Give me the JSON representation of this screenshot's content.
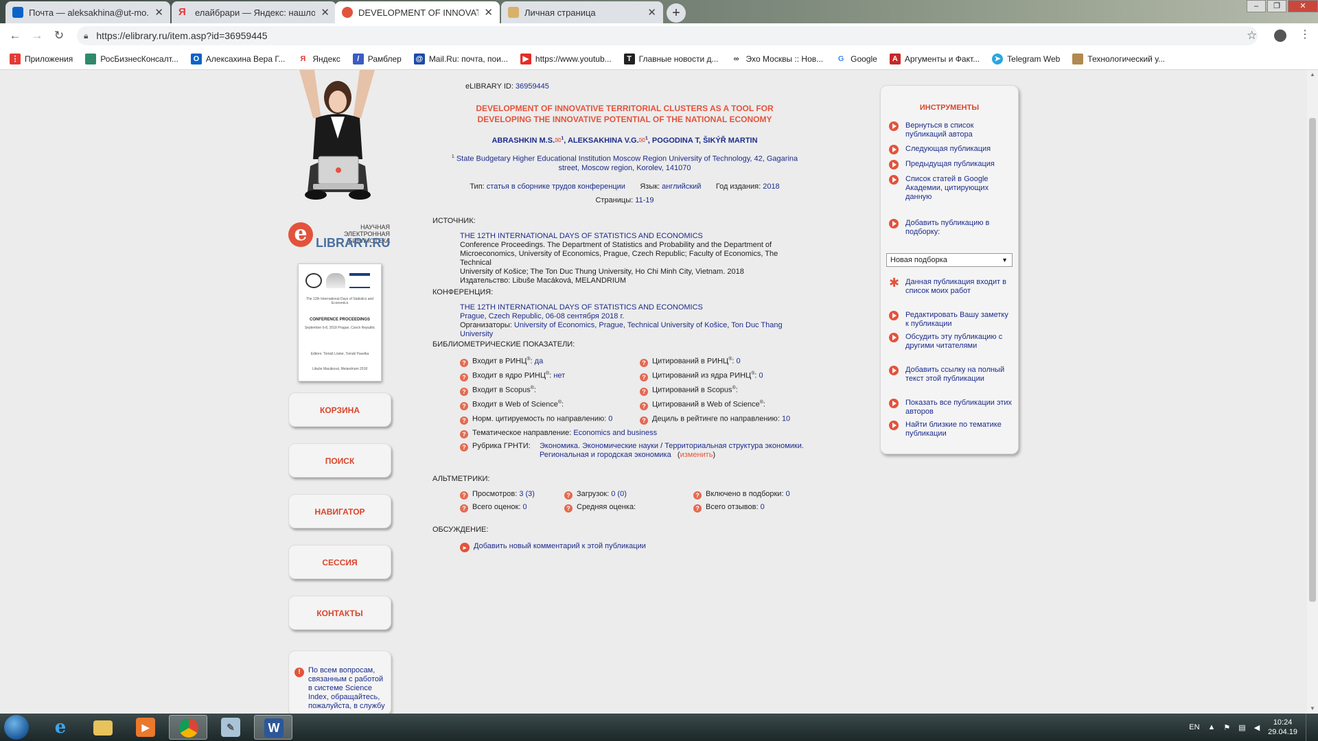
{
  "browser": {
    "tabs": [
      {
        "title": "Почта — aleksakhina@ut-mo.ru",
        "icon": "outlook-icon",
        "color": "#0a64c8"
      },
      {
        "title": "елайбрари — Яндекс: нашлось",
        "icon": "yandex-icon",
        "color": "#e53935"
      },
      {
        "title": "DEVELOPMENT OF INNOVATIVE",
        "icon": "elibrary-icon",
        "color": "#e3533c"
      },
      {
        "title": "Личная страница",
        "icon": "page-icon",
        "color": "#d9b06a"
      }
    ],
    "new_tab": "+",
    "url": "https://elibrary.ru/item.asp?id=36959445",
    "bookmarks": [
      {
        "label": "Приложения",
        "color": "#e53935"
      },
      {
        "label": "РосБизнесКонсалт...",
        "color": "#2f8a6b"
      },
      {
        "label": "Алексахина Вера Г...",
        "color": "#0a64c8"
      },
      {
        "label": "Яндекс",
        "color": "#e53935"
      },
      {
        "label": "Рамблер",
        "color": "#3b5cc4"
      },
      {
        "label": "Mail.Ru: почта, пои...",
        "color": "#1c4aa8"
      },
      {
        "label": "https://www.youtub...",
        "color": "#e52d27"
      },
      {
        "label": "Главные новости д...",
        "color": "#222222"
      },
      {
        "label": "Эхо Москвы :: Нов...",
        "color": "#333333"
      },
      {
        "label": "Google",
        "color": "#4285f4"
      },
      {
        "label": "Аргументы и Факт...",
        "color": "#c62828"
      },
      {
        "label": "Telegram Web",
        "color": "#2ca5e0"
      },
      {
        "label": "Технологический у...",
        "color": "#b08a50"
      }
    ]
  },
  "left": {
    "logo_top": "НАУЧНАЯ ЭЛЕКТРОННАЯ БИБЛИОТЕКА",
    "logo_main": "LIBRARY.RU",
    "logo_e": "e",
    "cover": {
      "small": "The 12th International Days of Statistics and Economics",
      "title": "CONFERENCE PROCEEDINGS",
      "dates": "September 6-8, 2018 Prague, Czech Republic",
      "editors": "Editors: Tomáš Löster, Tomáš Pavelka",
      "publisher": "Libuše Macáková, Melandrium 2018"
    },
    "buttons": [
      "КОРЗИНА",
      "ПОИСК",
      "НАВИГАТОР",
      "СЕССИЯ",
      "КОНТАКТЫ"
    ],
    "help_text": "По всем вопросам, связанным с работой в системе Science Index, обращайтесь, пожалуйста, в службу"
  },
  "main": {
    "id_label": "eLIBRARY ID:",
    "id_value": "36959445",
    "title_line1": "DEVELOPMENT OF INNOVATIVE TERRITORIAL CLUSTERS AS A TOOL FOR",
    "title_line2": "DEVELOPING THE INNOVATIVE POTENTIAL OF THE NATIONAL ECONOMY",
    "authors": [
      {
        "name": "ABRASHKIN M.S.",
        "sup": "1",
        "mail": true
      },
      {
        "name": "ALEKSAKHINA V.G.",
        "sup": "1",
        "mail": true
      },
      {
        "name": "POGODINA T",
        "sup": "",
        "mail": false
      },
      {
        "name": "ŠIKÝŘ MARTIN",
        "sup": "",
        "mail": false
      }
    ],
    "affiliation_sup": "1",
    "affiliation_line1": "State Budgetary Higher Educational Institution Moscow Region University of Technology, 42, Gagarina",
    "affiliation_line2": "street, Moscow region, Korolev, 141070",
    "type_label": "Тип:",
    "type_value": "статья в сборнике трудов конференции",
    "lang_label": "Язык:",
    "lang_value": "английский",
    "year_label": "Год издания:",
    "year_value": "2018",
    "pages_label": "Страницы:",
    "pages_value": "11-19",
    "source_label": "ИСТОЧНИК:",
    "source_title": "THE 12TH INTERNATIONAL DAYS OF STATISTICS AND ECONOMICS",
    "source_lines": [
      "Conference Proceedings. The Department of Statistics and Probability and the Department of",
      "Microeconomics, University of Economics, Prague, Czech Republic; Faculty of Economics, The Technical",
      "University of Košice; The Ton Duc Thung University, Ho Chi Minh City, Vietnam. 2018"
    ],
    "publisher_label": "Издательство:",
    "publisher_value": "Libuše Macáková, MELANDRIUM",
    "conf_label": "КОНФЕРЕНЦИЯ:",
    "conf_title": "THE 12TH INTERNATIONAL DAYS OF STATISTICS AND ECONOMICS",
    "conf_place": "Prague, Czech Republic, 06-08 сентября 2018 г.",
    "organizers_label": "Организаторы:",
    "organizers": [
      "University of Economics, Prague",
      "Technical University of Košice",
      "Ton Duc Thang University"
    ],
    "biblio_label": "БИБЛИОМЕТРИЧЕСКИЕ ПОКАЗАТЕЛИ:",
    "metrics_left": [
      {
        "label": "Входит в РИНЦ",
        "sup": "®",
        "sep": ":",
        "value": "да"
      },
      {
        "label": "Входит в ядро РИНЦ",
        "sup": "®",
        "sep": ":",
        "value": "нет"
      },
      {
        "label": "Входит в Scopus",
        "sup": "®",
        "sep": ":",
        "value": ""
      },
      {
        "label": "Входит в Web of Science",
        "sup": "®",
        "sep": ":",
        "value": ""
      },
      {
        "label": "Норм. цитируемость по направлению",
        "sup": "",
        "sep": ":",
        "value": "0"
      }
    ],
    "metrics_right": [
      {
        "label": "Цитирований в РИНЦ",
        "sup": "®",
        "sep": ":",
        "value": "0"
      },
      {
        "label": "Цитирований из ядра РИНЦ",
        "sup": "®",
        "sep": ":",
        "value": "0"
      },
      {
        "label": "Цитирований в Scopus",
        "sup": "®",
        "sep": ":",
        "value": ""
      },
      {
        "label": "Цитирований в Web of Science",
        "sup": "®",
        "sep": ":",
        "value": ""
      },
      {
        "label": "Дециль в рейтинге по направлению",
        "sup": "",
        "sep": ":",
        "value": "10"
      }
    ],
    "thematic_label": "Тематическое направление:",
    "thematic_value": "Economics and business",
    "grnti_label": "Рубрика ГРНТИ:",
    "grnti_line1a": "Экономика. Экономические науки",
    "grnti_slash": "/",
    "grnti_line1b": "Территориальная структура экономики.",
    "grnti_line2": "Региональная и городская экономика",
    "grnti_change": "изменить",
    "alt_label": "АЛЬТМЕТРИКИ:",
    "alt": [
      {
        "label": "Просмотров:",
        "value": "3 (3)"
      },
      {
        "label": "Загрузок:",
        "value": "0 (0)"
      },
      {
        "label": "Включено в подборки:",
        "value": "0"
      },
      {
        "label": "Всего оценок:",
        "value": "0"
      },
      {
        "label": "Средняя оценка:",
        "value": ""
      },
      {
        "label": "Всего отзывов:",
        "value": "0"
      }
    ],
    "discussion_label": "ОБСУЖДЕНИЕ:",
    "add_comment": "Добавить новый комментарий к этой публикации"
  },
  "tools": {
    "title": "ИНСТРУМЕНТЫ",
    "items": [
      "Вернуться в список публикаций автора",
      "Следующая публикация",
      "Предыдущая публикация",
      "Список статей в Google Академии, цитирующих данную",
      "Добавить публикацию в подборку:",
      "Данная публикация входит в список моих работ",
      "Редактировать Вашу заметку к публикации",
      "Обсудить эту публикацию с другими читателями",
      "Добавить ссылку на полный текст этой публикации",
      "Показать все публикации этих авторов",
      "Найти близкие по тематике публикации"
    ],
    "select_value": "Новая подборка"
  },
  "taskbar": {
    "lang": "EN",
    "time": "10:24",
    "date": "29.04.19"
  }
}
